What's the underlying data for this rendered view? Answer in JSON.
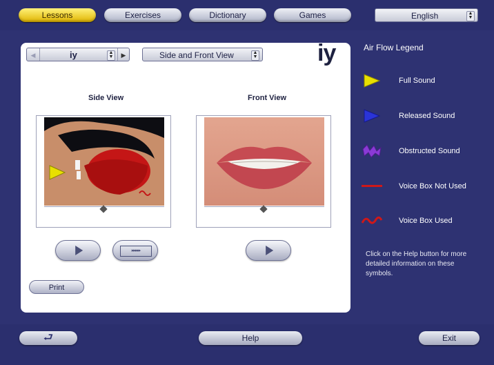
{
  "nav": {
    "tabs": [
      {
        "label": "Lessons"
      },
      {
        "label": "Exercises"
      },
      {
        "label": "Dictionary"
      },
      {
        "label": "Games"
      }
    ],
    "language": "English"
  },
  "lesson": {
    "selected_sound": "iy",
    "view_mode": "Side and Front View",
    "big_symbol": "iy",
    "side_caption": "Side View",
    "front_caption": "Front View",
    "print_label": "Print"
  },
  "legend": {
    "title": "Air Flow Legend",
    "items": [
      {
        "label": "Full Sound",
        "color": "#e8e000"
      },
      {
        "label": "Released Sound",
        "color": "#2a34d8"
      },
      {
        "label": "Obstructed Sound",
        "color": "#8a3ad6"
      },
      {
        "label": "Voice Box Not Used",
        "color": "#d01818"
      },
      {
        "label": "Voice Box Used",
        "color": "#d01818"
      }
    ],
    "help_text": "Click on the Help button for more detailed information on these symbols."
  },
  "footer": {
    "help_label": "Help",
    "exit_label": "Exit"
  },
  "colors": {
    "background": "#2e3272",
    "panel": "#ffffff",
    "active_tab": "#f5d400"
  }
}
